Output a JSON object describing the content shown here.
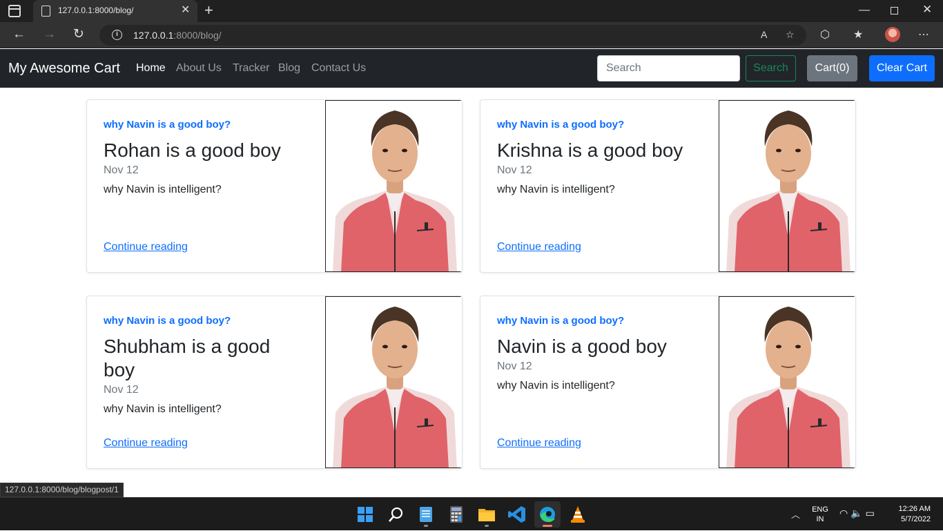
{
  "browser": {
    "tab_title": "127.0.0.1:8000/blog/",
    "tab_close": "✕",
    "new_tab": "+",
    "url_host": "127.0.0.1",
    "url_rest": ":8000/blog/",
    "status_url": "127.0.0.1:8000/blog/blogpost/1"
  },
  "navbar": {
    "brand": "My Awesome Cart",
    "links": [
      "Home",
      "About Us",
      "Tracker",
      "Blog",
      "Contact Us"
    ],
    "active_link": "Home",
    "search_placeholder": "Search",
    "search_button": "Search",
    "cart_button": "Cart(0)",
    "clear_cart_button": "Clear Cart"
  },
  "posts": [
    {
      "category": "why Navin is a good boy?",
      "title": "Rohan is a good boy",
      "date": "Nov 12",
      "excerpt": "why Navin is intelligent?",
      "link": "Continue reading"
    },
    {
      "category": "why Navin is a good boy?",
      "title": "Krishna is a good boy",
      "date": "Nov 12",
      "excerpt": "why Navin is intelligent?",
      "link": "Continue reading"
    },
    {
      "category": "why Navin is a good boy?",
      "title": "Shubham is a good boy",
      "date": "Nov 12",
      "excerpt": "why Navin is intelligent?",
      "link": "Continue reading"
    },
    {
      "category": "why Navin is a good boy?",
      "title": "Navin is a good boy",
      "date": "Nov 12",
      "excerpt": "why Navin is intelligent?",
      "link": "Continue reading"
    }
  ],
  "taskbar": {
    "apps": [
      "start-icon",
      "search-icon",
      "notepad-icon",
      "calculator-icon",
      "file-explorer-icon",
      "vscode-icon",
      "edge-icon",
      "vlc-icon"
    ],
    "active_app": "edge-icon",
    "lang_line1": "ENG",
    "lang_line2": "IN",
    "time": "12:26 AM",
    "date": "5/7/2022"
  },
  "colors": {
    "navbar_bg": "#212529",
    "primary": "#0d6efd",
    "success": "#198754",
    "secondary": "#6c757d"
  }
}
